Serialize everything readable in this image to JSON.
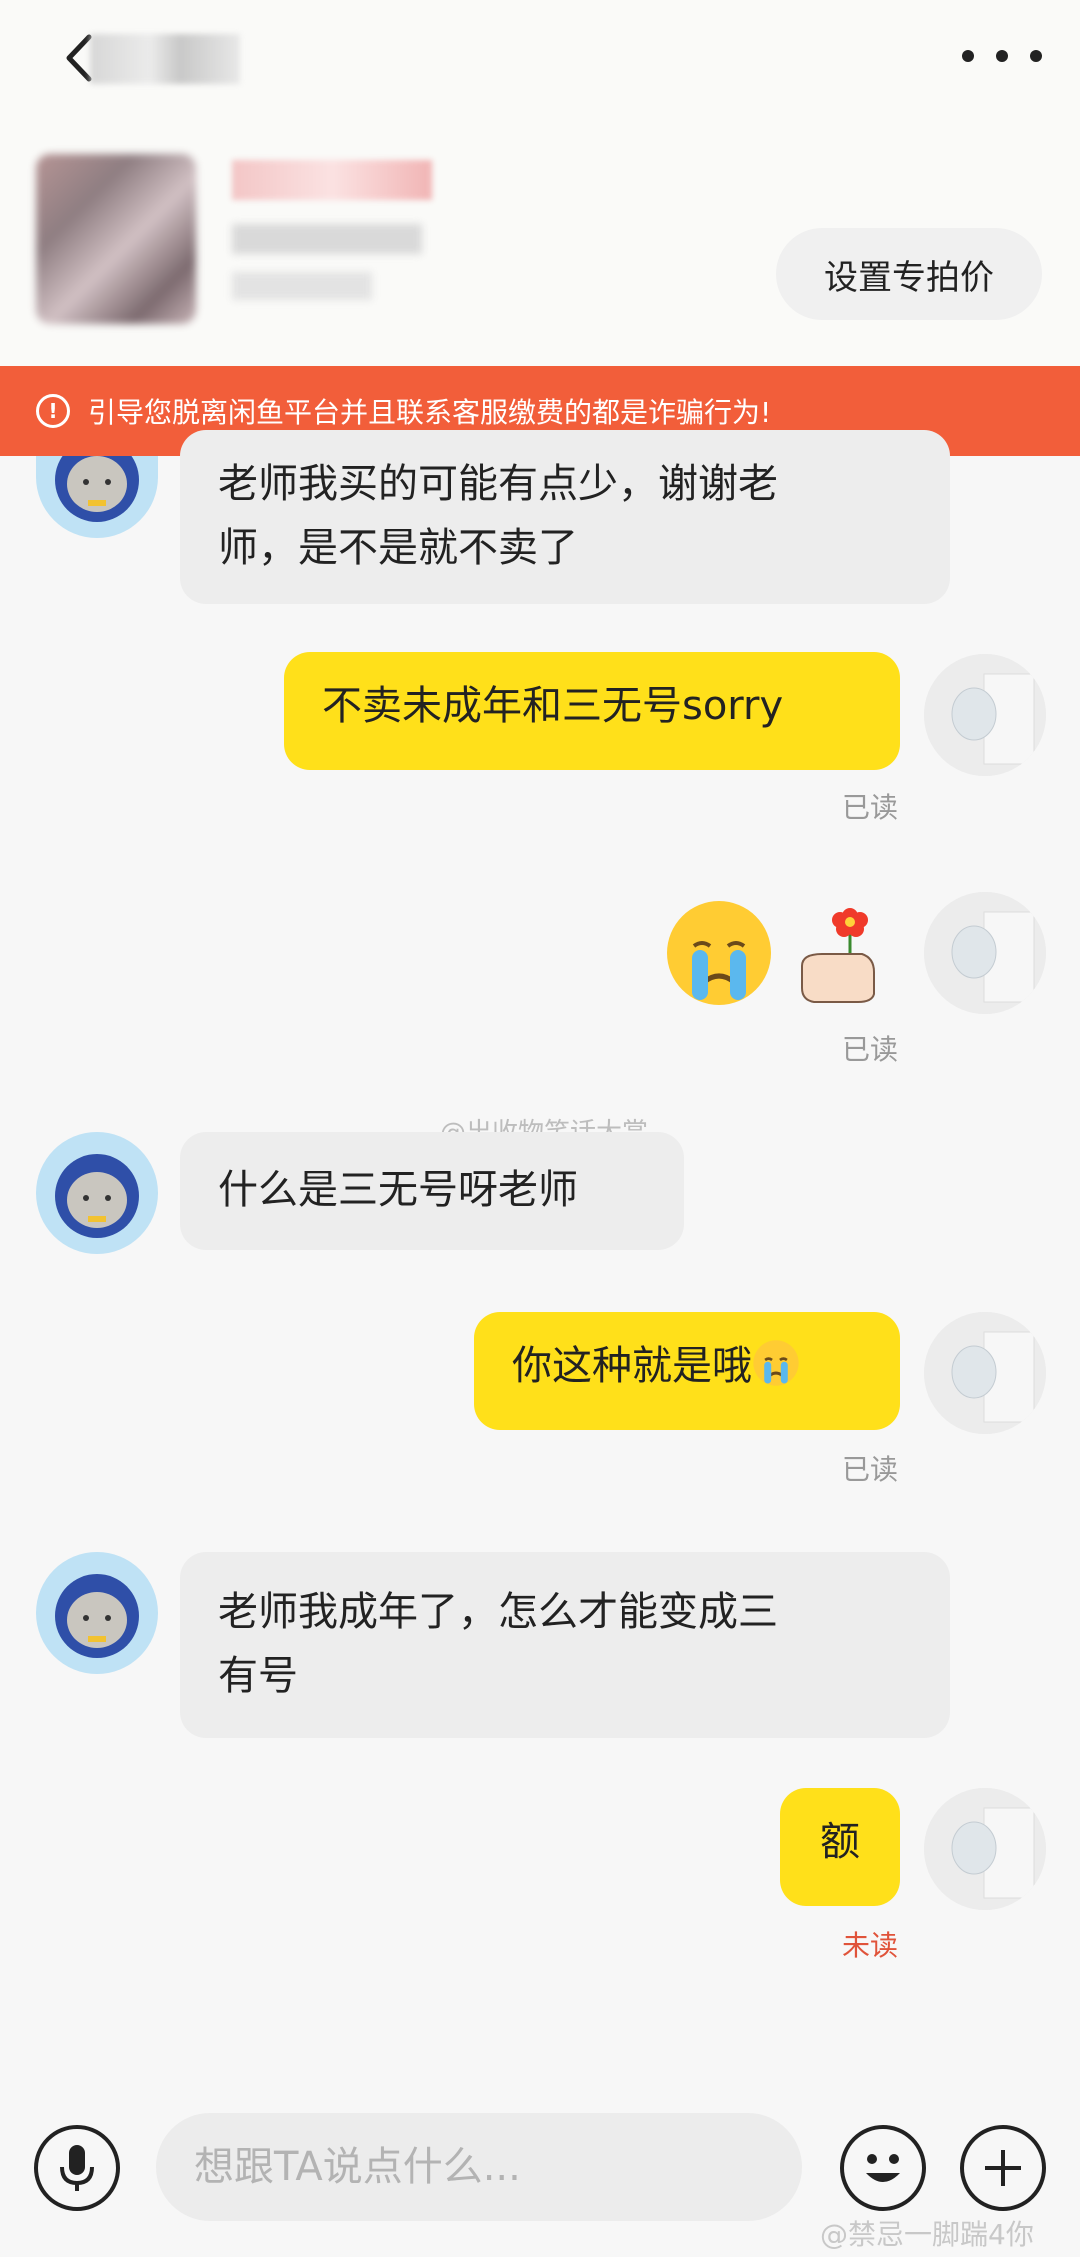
{
  "header": {
    "set_price_label": "设置专拍价",
    "back_icon": "chevron-left-icon",
    "more_icon": "more-dots-icon"
  },
  "warning": {
    "text": "引导您脱离闲鱼平台并且联系客服缴费的都是诈骗行为!",
    "icon": "warning-circle-icon",
    "color": "#f25e3a"
  },
  "messages": [
    {
      "from": "other",
      "text_line1": "老师我买的可能有点少，谢谢老",
      "text_line2": "师，是不是就不卖了"
    },
    {
      "from": "me",
      "text": "不卖未成年和三无号sorry",
      "status": "已读"
    },
    {
      "from": "me",
      "emoji": [
        "crying-face-emoji",
        "hand-holding-flower-emoji"
      ],
      "status": "已读"
    },
    {
      "from": "other",
      "text": "什么是三无号呀老师"
    },
    {
      "from": "me",
      "text": "你这种就是哦",
      "emoji_inline": "crying-face-emoji",
      "status": "已读"
    },
    {
      "from": "other",
      "text_line1": "老师我成年了，怎么才能变成三",
      "text_line2": "有号"
    },
    {
      "from": "me",
      "text": "额",
      "status": "未读"
    }
  ],
  "watermarks": {
    "mid": "@出收物笑话大赏",
    "bottom": "@禁忌一脚踹4你"
  },
  "input": {
    "placeholder": "想跟TA说点什么..."
  },
  "colors": {
    "outgoing_bubble": "#ffe01a",
    "incoming_bubble": "#ededed",
    "unread": "#e0533a"
  }
}
